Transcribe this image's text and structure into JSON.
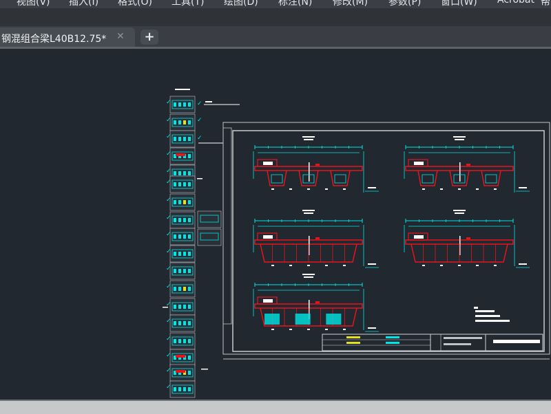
{
  "menu": {
    "items": [
      "视图(V)",
      "插入(I)",
      "格式(O)",
      "工具(T)",
      "绘图(D)",
      "标注(N)",
      "修改(M)",
      "参数(P)",
      "窗口(W)",
      "Acrobat",
      "帮"
    ]
  },
  "document_tab": {
    "title": "钢混组合梁L40B12.75*",
    "close_symbol": "✕"
  },
  "new_tab_symbol": "+",
  "colors": {
    "canvas_bg": "#212830",
    "cyan": "#00e5e5",
    "red": "#e8141c",
    "white": "#ffffff",
    "frame": "#b8bcc0"
  },
  "icons": {
    "close": "close-icon",
    "add": "plus-icon"
  }
}
